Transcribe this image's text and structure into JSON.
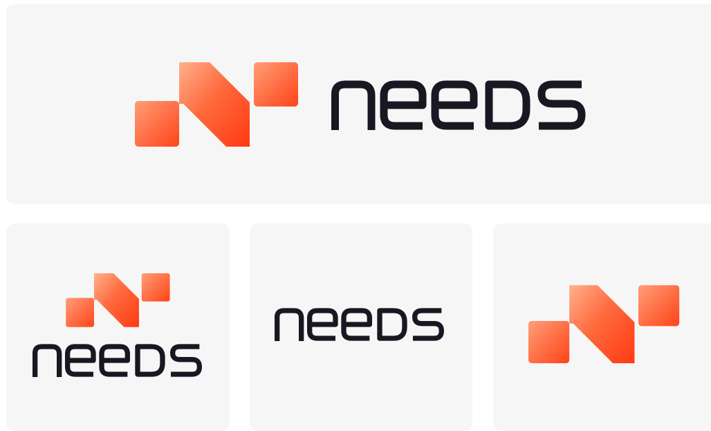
{
  "brand": {
    "name": "needs",
    "wordmark_color": "#171821",
    "accent_gradient": [
      "#ffb08d",
      "#ff6a3d",
      "#ff3a12"
    ]
  },
  "cards": [
    {
      "variant": "horizontal-lockup"
    },
    {
      "variant": "stacked-lockup"
    },
    {
      "variant": "wordmark-only"
    },
    {
      "variant": "symbol-only"
    }
  ]
}
